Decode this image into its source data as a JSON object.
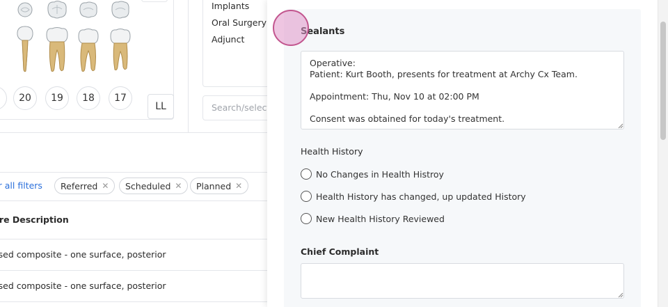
{
  "background": {
    "tooth_numbers": [
      "20",
      "19",
      "18",
      "17"
    ],
    "quadrant_label": "LL",
    "procedure_categories": [
      "Implants",
      "Oral Surgery",
      "Adjunct"
    ],
    "search_placeholder": "Search/select p",
    "filters": {
      "clear_label": "ar all filters",
      "chips": [
        "Referred",
        "Scheduled",
        "Planned"
      ]
    },
    "table": {
      "column_header": "ure Description",
      "rows": [
        "ased composite - one surface, posterior",
        "ased composite - one surface, posterior"
      ]
    }
  },
  "panel": {
    "section_title": "Sealants",
    "notes_text": "Operative:\nPatient: Kurt Booth, presents for treatment at Archy Cx Team.\n\nAppointment: Thu, Nov 10 at 02:00 PM\n\nConsent was obtained for today's treatment.",
    "health_history": {
      "label": "Health History",
      "options": [
        "No Changes in Health Histroy",
        "Health History has changed, up updated History",
        "New Health History Reviewed"
      ]
    },
    "chief_complaint": {
      "label": "Chief Complaint",
      "value": ""
    }
  },
  "colors": {
    "link": "#2a6fdb",
    "cursor_fill": "#e096c8",
    "cursor_border": "#c2558e",
    "card_bg": "#f6f8fa"
  }
}
